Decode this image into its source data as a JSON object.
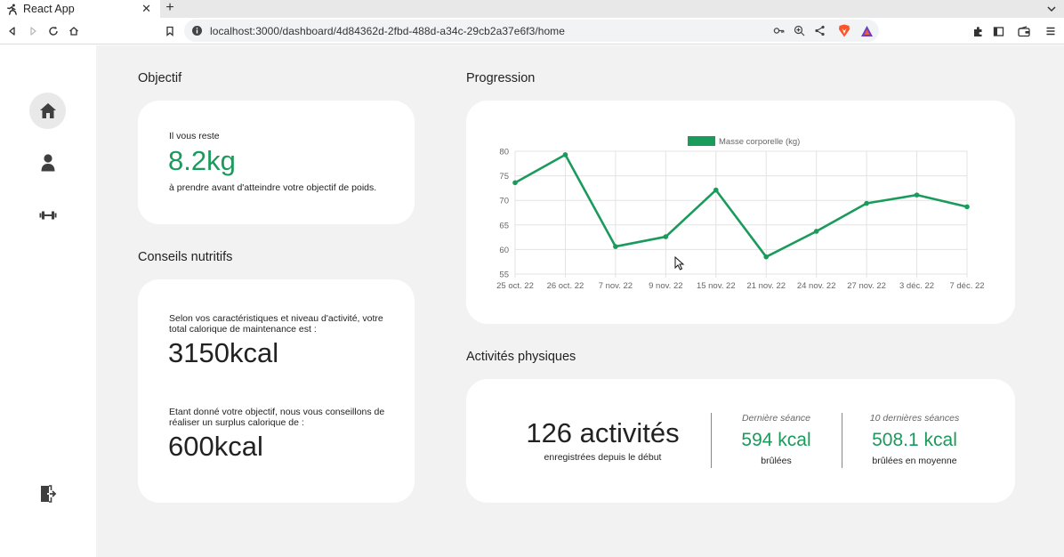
{
  "browser": {
    "tab_title": "React App",
    "url": "localhost:3000/dashboard/4d84362d-2fbd-488d-a34c-29cb2a37e6f3/home"
  },
  "sidebar": {
    "items": [
      {
        "name": "home-icon",
        "active": true
      },
      {
        "name": "user-icon",
        "active": false
      },
      {
        "name": "dumbbell-icon",
        "active": false
      }
    ],
    "logout": "logout-icon"
  },
  "objectif": {
    "title": "Objectif",
    "pre": "Il vous reste",
    "value": "8.2kg",
    "post": "à prendre avant d'atteindre votre objectif de poids."
  },
  "conseils": {
    "title": "Conseils nutritifs",
    "text1": "Selon vos caractéristiques et niveau d'activité, votre total calorique de maintenance est :",
    "value1": "3150kcal",
    "text2": "Etant donné votre objectif, nous vous conseillons de réaliser un surplus calorique de :",
    "value2": "600kcal"
  },
  "progression": {
    "title": "Progression"
  },
  "activites": {
    "title": "Activités physiques",
    "count": "126 activités",
    "count_sub": "enregistrées depuis le début",
    "last_label": "Dernière séance",
    "last_value": "594 kcal",
    "last_sub": "brûlées",
    "avg_label": "10 dernières séances",
    "avg_value": "508.1 kcal",
    "avg_sub": "brûlées en moyenne"
  },
  "colors": {
    "accent": "#1a9a5b",
    "background": "#f2f2f2",
    "card": "#ffffff"
  },
  "chart_data": {
    "type": "line",
    "categories": [
      "25 oct. 22",
      "26 oct. 22",
      "7 nov. 22",
      "9 nov. 22",
      "15 nov. 22",
      "21 nov. 22",
      "24 nov. 22",
      "27 nov. 22",
      "3 déc. 22",
      "7 déc. 22"
    ],
    "series": [
      {
        "name": "Masse corporelle (kg)",
        "values": [
          73.6,
          79.3,
          60.6,
          62.6,
          72.1,
          58.5,
          63.7,
          69.4,
          71.1,
          68.7
        ]
      }
    ],
    "yticks": [
      55,
      60,
      65,
      70,
      75,
      80
    ],
    "ylim": [
      55,
      80
    ],
    "grid": true,
    "legend": "top",
    "color": "#1a9a5b"
  }
}
